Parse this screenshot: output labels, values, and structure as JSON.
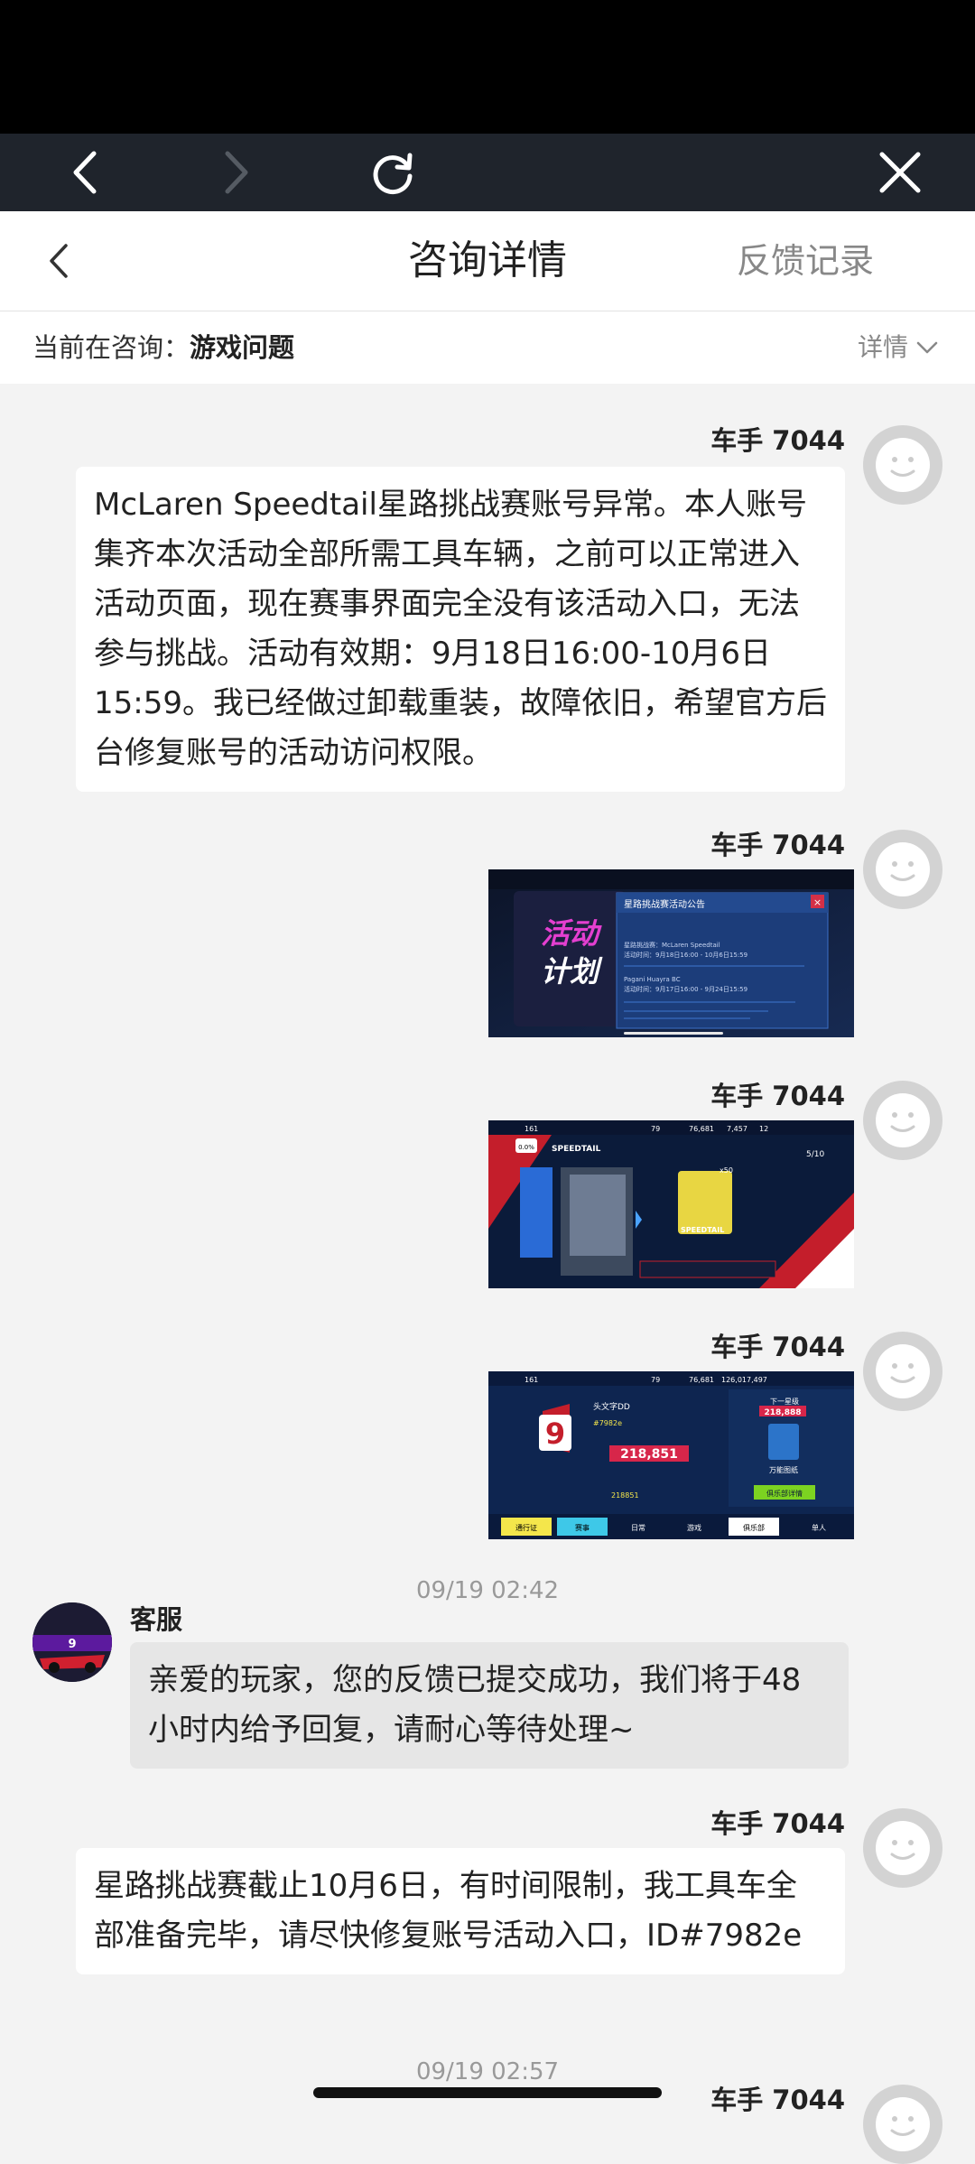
{
  "header": {
    "title": "咨询详情",
    "feedback_label": "反馈记录"
  },
  "topic": {
    "label": "当前在咨询：",
    "value": "游戏问题",
    "detail_label": "详情"
  },
  "messages": [
    {
      "sender": "车手 7044",
      "text": "McLaren Speedtail星路挑战赛账号异常。本人账号集齐本次活动全部所需工具车辆，之前可以正常进入活动页面，现在赛事界面完全没有该活动入口，无法参与挑战。活动有效期：9月18日16:00-10月6日15:59。我已经做过卸载重装，故障依旧，希望官方后台修复账号的活动访问权限。"
    },
    {
      "sender": "车手 7044",
      "image": "活动计划 announcement screenshot"
    },
    {
      "sender": "车手 7044",
      "image": "SPEEDTAIL event screenshot"
    },
    {
      "sender": "车手 7044",
      "image": "club rating screenshot"
    },
    {
      "sender": "客服",
      "timestamp": "09/19 02:42",
      "text": "亲爱的玩家，您的反馈已提交成功，我们将于48小时内给予回复，请耐心等待处理~"
    },
    {
      "sender": "车手 7044",
      "text": "星路挑战赛截止10月6日，有时间限制，我工具车全部准备完毕，请尽快修复账号活动入口，ID#7982e"
    },
    {
      "sender": "车手 7044",
      "timestamp": "09/19 02:57"
    }
  ],
  "screens": {
    "s1": {
      "poster": [
        "活动",
        "计划"
      ],
      "panel_title": "星路挑战赛活动公告",
      "lines": [
        "星路挑战赛：McLaren Speedtail",
        "活动时间：9月18日16:00 - 10月6日15:59",
        "Pagani Huayra BC",
        "活动时间：9月17日16:00 - 9月24日15:59"
      ]
    },
    "s2": {
      "stats": [
        "161",
        "79",
        "76,681",
        "7,457",
        "12"
      ],
      "title": "SPEEDTAIL",
      "percent": "0.0%",
      "count": "5/10",
      "card_label": "SPEEDTAIL",
      "x50": "x50"
    },
    "s3": {
      "stats": [
        "161",
        "79",
        "76,681",
        "126,017,497"
      ],
      "rank_label": "9",
      "player": "头文字DD",
      "tag": "#7982e",
      "score": "218,851",
      "bottom_score": "218851",
      "next_tier_label": "下一星级",
      "next_tier": "218,888",
      "reward": "万能图纸",
      "club_btn": "俱乐部详情",
      "tabs": [
        "通行证",
        "赛事",
        "日常",
        "游戏",
        "俱乐部",
        "单人"
      ]
    }
  },
  "colors": {
    "browser_bar": "#1f242c",
    "status_bar": "#000000",
    "page_bg": "#f3f3f3",
    "bubble_user": "#ffffff",
    "bubble_agent": "#e6e6e6"
  }
}
